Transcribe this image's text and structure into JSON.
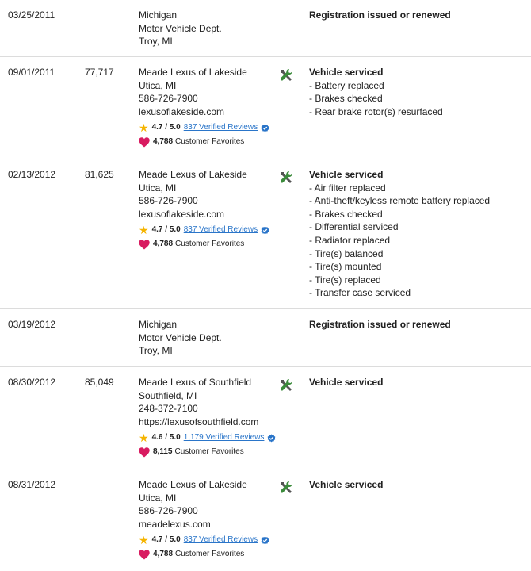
{
  "records": [
    {
      "date": "03/25/2011",
      "odometer": "",
      "source": [
        "Michigan",
        "Motor Vehicle Dept.",
        "Troy, MI"
      ],
      "icon": "",
      "title": "Registration issued or renewed",
      "items": []
    },
    {
      "date": "09/01/2011",
      "odometer": "77,717",
      "source": [
        "Meade Lexus of Lakeside",
        "Utica, MI",
        "586-726-7900",
        "lexusoflakeside.com"
      ],
      "rating": {
        "score": "4.7 / 5.0",
        "reviews": "837 Verified Reviews",
        "favorites": "4,788",
        "favorites_label": "Customer Favorites"
      },
      "icon": "service-tools-icon",
      "title": "Vehicle serviced",
      "items": [
        "Battery replaced",
        "Brakes checked",
        "Rear brake rotor(s) resurfaced"
      ]
    },
    {
      "date": "02/13/2012",
      "odometer": "81,625",
      "source": [
        "Meade Lexus of Lakeside",
        "Utica, MI",
        "586-726-7900",
        "lexusoflakeside.com"
      ],
      "rating": {
        "score": "4.7 / 5.0",
        "reviews": "837 Verified Reviews",
        "favorites": "4,788",
        "favorites_label": "Customer Favorites"
      },
      "icon": "service-tools-icon",
      "title": "Vehicle serviced",
      "items": [
        "Air filter replaced",
        "Anti-theft/keyless remote battery replaced",
        "Brakes checked",
        "Differential serviced",
        "Radiator replaced",
        "Tire(s) balanced",
        "Tire(s) mounted",
        "Tire(s) replaced",
        "Transfer case serviced"
      ]
    },
    {
      "date": "03/19/2012",
      "odometer": "",
      "source": [
        "Michigan",
        "Motor Vehicle Dept.",
        "Troy, MI"
      ],
      "icon": "",
      "title": "Registration issued or renewed",
      "items": []
    },
    {
      "date": "08/30/2012",
      "odometer": "85,049",
      "source": [
        "Meade Lexus of Southfield",
        "Southfield, MI",
        "248-372-7100",
        "https://lexusofsouthfield.com"
      ],
      "rating": {
        "score": "4.6 / 5.0",
        "reviews": "1,179 Verified Reviews",
        "favorites": "8,115",
        "favorites_label": "Customer Favorites"
      },
      "icon": "service-tools-icon",
      "title": "Vehicle serviced",
      "items": []
    },
    {
      "date": "08/31/2012",
      "odometer": "",
      "source": [
        "Meade Lexus of Lakeside",
        "Utica, MI",
        "586-726-7900",
        "meadelexus.com"
      ],
      "rating": {
        "score": "4.7 / 5.0",
        "reviews": "837 Verified Reviews",
        "favorites": "4,788",
        "favorites_label": "Customer Favorites"
      },
      "icon": "service-tools-icon",
      "title": "Vehicle serviced",
      "items": []
    }
  ],
  "colors": {
    "link": "#2a75c9",
    "star": "#f5b400",
    "heart": "#d81b60",
    "verified": "#2a75c9",
    "tool_green": "#3b8b3b",
    "divider": "#dcdcdc"
  }
}
